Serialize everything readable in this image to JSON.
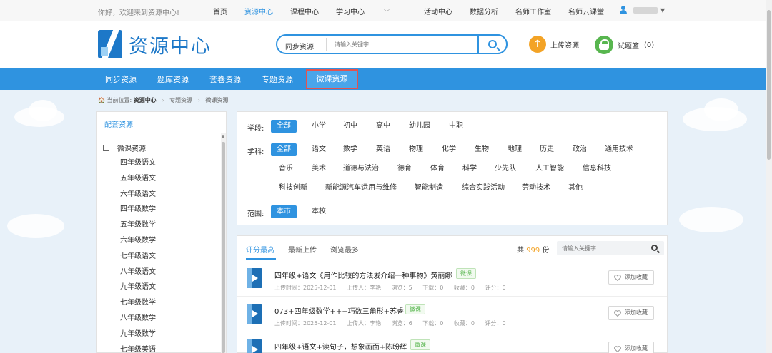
{
  "topbar": {
    "welcome": "你好，欢迎来到资源中心!",
    "nav": [
      {
        "label": "首页",
        "active": false
      },
      {
        "label": "资源中心",
        "active": true
      },
      {
        "label": "课程中心",
        "active": false
      },
      {
        "label": "学习中心",
        "active": false,
        "dropdown": true
      },
      {
        "label": "活动中心",
        "active": false
      },
      {
        "label": "数据分析",
        "active": false
      },
      {
        "label": "名师工作室",
        "active": false
      },
      {
        "label": "名师云课堂",
        "active": false
      }
    ]
  },
  "header": {
    "logo_text": "资源中心",
    "search_category": "同步资源",
    "search_placeholder": "请输入关键字",
    "upload_label": "上传资源",
    "basket_label": "试题篮",
    "basket_count": "(0)"
  },
  "mainnav": [
    "同步资源",
    "题库资源",
    "套卷资源",
    "专题资源",
    "微课资源"
  ],
  "breadcrumb": {
    "prefix": "当前位置:",
    "items": [
      "资源中心",
      "专题资源",
      "微课资源"
    ]
  },
  "sidebar": {
    "title": "配套资源",
    "root": "微课资源",
    "items": [
      "四年级语文",
      "五年级语文",
      "六年级语文",
      "四年级数学",
      "五年级数学",
      "六年级数学",
      "七年级语文",
      "八年级语文",
      "九年级语文",
      "七年级数学",
      "八年级数学",
      "九年级数学",
      "七年级英语"
    ]
  },
  "filters": {
    "stage_label": "学段:",
    "stages": [
      "全部",
      "小学",
      "初中",
      "高中",
      "幼儿园",
      "中职"
    ],
    "subject_label": "学科:",
    "subjects_row1": [
      "全部",
      "语文",
      "数学",
      "英语",
      "物理",
      "化学",
      "生物",
      "地理",
      "历史",
      "政治",
      "通用技术"
    ],
    "subjects_row2": [
      "音乐",
      "美术",
      "道德与法治",
      "德育",
      "体育",
      "科学",
      "少先队",
      "人工智能",
      "信息科技"
    ],
    "subjects_row3": [
      "科技创新",
      "新能源汽车运用与维修",
      "智能制造",
      "综合实践活动",
      "劳动技术",
      "其他"
    ],
    "scope_label": "范围:",
    "scopes": [
      "本市",
      "本校"
    ]
  },
  "list": {
    "tabs": [
      "评分最高",
      "最新上传",
      "浏览最多"
    ],
    "total_prefix": "共",
    "total_count": "999",
    "total_suffix": "份",
    "search_placeholder": "请输入关键字",
    "fav_label": "添加收藏",
    "badge": "微课",
    "rows": [
      {
        "title": "四年级+语文《用作比较的方法发介绍一种事物》黄丽娜",
        "time": "上传时间：2025-12-01",
        "uploader": "上传人：李艳",
        "views": "浏览：5",
        "downloads": "下载：0",
        "favs": "收藏：0",
        "score": "评分：0"
      },
      {
        "title": "073+四年级数学+++巧数三角形+苏睿",
        "time": "上传时间：2025-12-01",
        "uploader": "上传人：李艳",
        "views": "浏览：6",
        "downloads": "下载：0",
        "favs": "收藏：0",
        "score": "评分：0"
      },
      {
        "title": "四年级+语文+读句子，想象画面+陈盼辉",
        "time": "",
        "uploader": "",
        "views": "",
        "downloads": "",
        "favs": "",
        "score": ""
      }
    ]
  },
  "colors": {
    "accent": "#2f93e0",
    "logo": "#1d78c8",
    "orange": "#f3a326",
    "green": "#58b64f",
    "highlight_border": "#e4524f"
  }
}
